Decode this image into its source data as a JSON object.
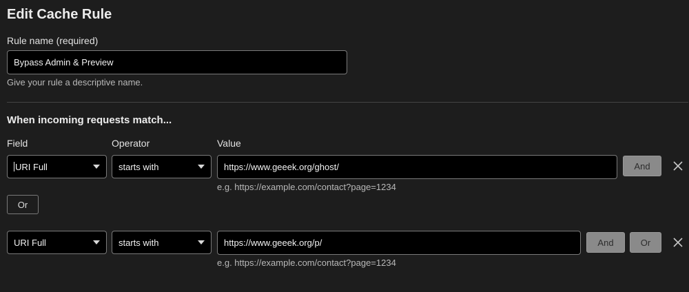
{
  "page_title": "Edit Cache Rule",
  "rule_name": {
    "label": "Rule name (required)",
    "value": "Bypass Admin & Preview",
    "help": "Give your rule a descriptive name."
  },
  "match": {
    "section_title": "When incoming requests match...",
    "headers": {
      "field": "Field",
      "operator": "Operator",
      "value": "Value"
    },
    "conditions": [
      {
        "field": "URI Full",
        "operator": "starts with",
        "value": "https://www.geeek.org/ghost/",
        "example": "e.g. https://example.com/contact?page=1234",
        "and_label": "And"
      },
      {
        "field": "URI Full",
        "operator": "starts with",
        "value": "https://www.geeek.org/p/",
        "example": "e.g. https://example.com/contact?page=1234",
        "and_label": "And",
        "or_label": "Or"
      }
    ],
    "or_button_label": "Or"
  },
  "icons": {
    "close": "close-icon",
    "dropdown": "chevron-down-icon"
  },
  "colors": {
    "background": "#1d1d1d",
    "input_bg": "#000000",
    "button_gray": "#8a8a8a"
  }
}
